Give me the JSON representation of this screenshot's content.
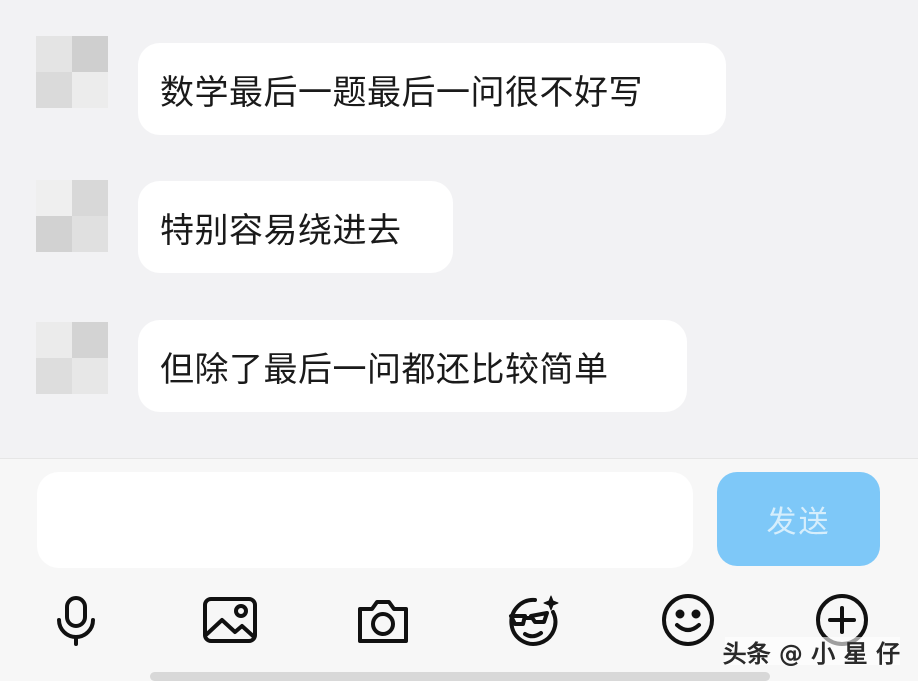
{
  "messages": [
    {
      "text": "数学最后一题最后一问很不好写"
    },
    {
      "text": "特别容易绕进去"
    },
    {
      "text": "但除了最后一问都还比较简单"
    }
  ],
  "composer": {
    "input_value": "",
    "send_label": "发送"
  },
  "toolbar": {
    "icons": [
      "microphone-icon",
      "image-icon",
      "camera-icon",
      "emoji-glasses-icon",
      "smiley-icon",
      "add-icon"
    ]
  },
  "overlay_text": "头条 @ 小 星 仔"
}
